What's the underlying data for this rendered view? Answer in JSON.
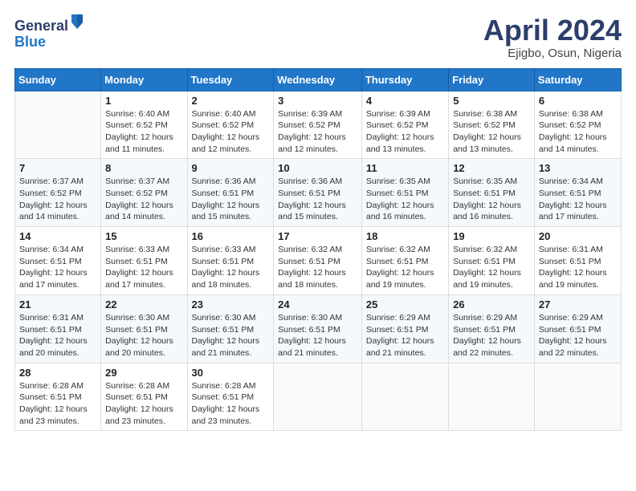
{
  "header": {
    "logo_general": "General",
    "logo_blue": "Blue",
    "month_title": "April 2024",
    "location": "Ejigbo, Osun, Nigeria"
  },
  "days_of_week": [
    "Sunday",
    "Monday",
    "Tuesday",
    "Wednesday",
    "Thursday",
    "Friday",
    "Saturday"
  ],
  "weeks": [
    [
      {
        "day": "",
        "info": ""
      },
      {
        "day": "1",
        "info": "Sunrise: 6:40 AM\nSunset: 6:52 PM\nDaylight: 12 hours\nand 11 minutes."
      },
      {
        "day": "2",
        "info": "Sunrise: 6:40 AM\nSunset: 6:52 PM\nDaylight: 12 hours\nand 12 minutes."
      },
      {
        "day": "3",
        "info": "Sunrise: 6:39 AM\nSunset: 6:52 PM\nDaylight: 12 hours\nand 12 minutes."
      },
      {
        "day": "4",
        "info": "Sunrise: 6:39 AM\nSunset: 6:52 PM\nDaylight: 12 hours\nand 13 minutes."
      },
      {
        "day": "5",
        "info": "Sunrise: 6:38 AM\nSunset: 6:52 PM\nDaylight: 12 hours\nand 13 minutes."
      },
      {
        "day": "6",
        "info": "Sunrise: 6:38 AM\nSunset: 6:52 PM\nDaylight: 12 hours\nand 14 minutes."
      }
    ],
    [
      {
        "day": "7",
        "info": "Sunrise: 6:37 AM\nSunset: 6:52 PM\nDaylight: 12 hours\nand 14 minutes."
      },
      {
        "day": "8",
        "info": "Sunrise: 6:37 AM\nSunset: 6:52 PM\nDaylight: 12 hours\nand 14 minutes."
      },
      {
        "day": "9",
        "info": "Sunrise: 6:36 AM\nSunset: 6:51 PM\nDaylight: 12 hours\nand 15 minutes."
      },
      {
        "day": "10",
        "info": "Sunrise: 6:36 AM\nSunset: 6:51 PM\nDaylight: 12 hours\nand 15 minutes."
      },
      {
        "day": "11",
        "info": "Sunrise: 6:35 AM\nSunset: 6:51 PM\nDaylight: 12 hours\nand 16 minutes."
      },
      {
        "day": "12",
        "info": "Sunrise: 6:35 AM\nSunset: 6:51 PM\nDaylight: 12 hours\nand 16 minutes."
      },
      {
        "day": "13",
        "info": "Sunrise: 6:34 AM\nSunset: 6:51 PM\nDaylight: 12 hours\nand 17 minutes."
      }
    ],
    [
      {
        "day": "14",
        "info": "Sunrise: 6:34 AM\nSunset: 6:51 PM\nDaylight: 12 hours\nand 17 minutes."
      },
      {
        "day": "15",
        "info": "Sunrise: 6:33 AM\nSunset: 6:51 PM\nDaylight: 12 hours\nand 17 minutes."
      },
      {
        "day": "16",
        "info": "Sunrise: 6:33 AM\nSunset: 6:51 PM\nDaylight: 12 hours\nand 18 minutes."
      },
      {
        "day": "17",
        "info": "Sunrise: 6:32 AM\nSunset: 6:51 PM\nDaylight: 12 hours\nand 18 minutes."
      },
      {
        "day": "18",
        "info": "Sunrise: 6:32 AM\nSunset: 6:51 PM\nDaylight: 12 hours\nand 19 minutes."
      },
      {
        "day": "19",
        "info": "Sunrise: 6:32 AM\nSunset: 6:51 PM\nDaylight: 12 hours\nand 19 minutes."
      },
      {
        "day": "20",
        "info": "Sunrise: 6:31 AM\nSunset: 6:51 PM\nDaylight: 12 hours\nand 19 minutes."
      }
    ],
    [
      {
        "day": "21",
        "info": "Sunrise: 6:31 AM\nSunset: 6:51 PM\nDaylight: 12 hours\nand 20 minutes."
      },
      {
        "day": "22",
        "info": "Sunrise: 6:30 AM\nSunset: 6:51 PM\nDaylight: 12 hours\nand 20 minutes."
      },
      {
        "day": "23",
        "info": "Sunrise: 6:30 AM\nSunset: 6:51 PM\nDaylight: 12 hours\nand 21 minutes."
      },
      {
        "day": "24",
        "info": "Sunrise: 6:30 AM\nSunset: 6:51 PM\nDaylight: 12 hours\nand 21 minutes."
      },
      {
        "day": "25",
        "info": "Sunrise: 6:29 AM\nSunset: 6:51 PM\nDaylight: 12 hours\nand 21 minutes."
      },
      {
        "day": "26",
        "info": "Sunrise: 6:29 AM\nSunset: 6:51 PM\nDaylight: 12 hours\nand 22 minutes."
      },
      {
        "day": "27",
        "info": "Sunrise: 6:29 AM\nSunset: 6:51 PM\nDaylight: 12 hours\nand 22 minutes."
      }
    ],
    [
      {
        "day": "28",
        "info": "Sunrise: 6:28 AM\nSunset: 6:51 PM\nDaylight: 12 hours\nand 23 minutes."
      },
      {
        "day": "29",
        "info": "Sunrise: 6:28 AM\nSunset: 6:51 PM\nDaylight: 12 hours\nand 23 minutes."
      },
      {
        "day": "30",
        "info": "Sunrise: 6:28 AM\nSunset: 6:51 PM\nDaylight: 12 hours\nand 23 minutes."
      },
      {
        "day": "",
        "info": ""
      },
      {
        "day": "",
        "info": ""
      },
      {
        "day": "",
        "info": ""
      },
      {
        "day": "",
        "info": ""
      }
    ]
  ]
}
